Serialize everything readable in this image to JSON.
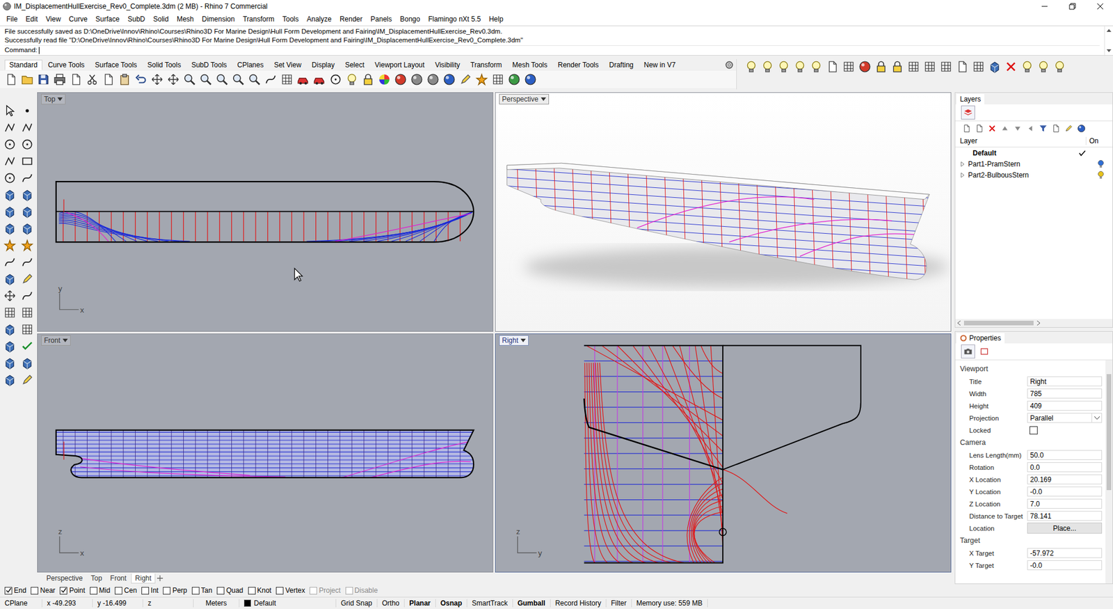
{
  "window": {
    "title": "IM_DisplacementHullExercise_Rev0_Complete.3dm (2 MB) - Rhino 7 Commercial"
  },
  "menu": [
    "File",
    "Edit",
    "View",
    "Curve",
    "Surface",
    "SubD",
    "Solid",
    "Mesh",
    "Dimension",
    "Transform",
    "Tools",
    "Analyze",
    "Render",
    "Panels",
    "Bongo",
    "Flamingo nXt 5.5",
    "Help"
  ],
  "command": {
    "history": [
      "File successfully saved as D:\\OneDrive\\Innov\\Rhino\\Courses\\Rhino3D For Marine Design\\Hull Form Development and Fairing\\IM_DisplacementHullExercise_Rev0.3dm.",
      "Successfully read file \"D:\\OneDrive\\Innov\\Rhino\\Courses\\Rhino3D For Marine Design\\Hull Form Development and Fairing\\IM_DisplacementHullExercise_Rev0_Complete.3dm\""
    ],
    "prompt": "Command:"
  },
  "toolbar_tabs": [
    {
      "label": "Standard",
      "selected": true
    },
    {
      "label": "Curve Tools",
      "selected": false
    },
    {
      "label": "Surface Tools",
      "selected": false
    },
    {
      "label": "Solid Tools",
      "selected": false
    },
    {
      "label": "SubD Tools",
      "selected": false
    },
    {
      "label": "CPlanes",
      "selected": false
    },
    {
      "label": "Set View",
      "selected": false
    },
    {
      "label": "Display",
      "selected": false
    },
    {
      "label": "Select",
      "selected": false
    },
    {
      "label": "Viewport Layout",
      "selected": false
    },
    {
      "label": "Visibility",
      "selected": false
    },
    {
      "label": "Transform",
      "selected": false
    },
    {
      "label": "Mesh Tools",
      "selected": false
    },
    {
      "label": "Render Tools",
      "selected": false
    },
    {
      "label": "Drafting",
      "selected": false
    },
    {
      "label": "New in V7",
      "selected": false
    }
  ],
  "viewports": [
    {
      "title": "Top",
      "kind": "plan",
      "active": false,
      "axis_labels": [
        "y",
        "x"
      ]
    },
    {
      "title": "Perspective",
      "kind": "perspective",
      "active": false,
      "axis_labels": []
    },
    {
      "title": "Front",
      "kind": "profile",
      "active": false,
      "axis_labels": [
        "z",
        "x"
      ]
    },
    {
      "title": "Right",
      "kind": "body",
      "active": true,
      "axis_labels": [
        "z",
        "y"
      ]
    }
  ],
  "viewport_tabs": [
    {
      "label": "Perspective",
      "selected": false
    },
    {
      "label": "Top",
      "selected": false
    },
    {
      "label": "Front",
      "selected": false
    },
    {
      "label": "Right",
      "selected": true
    }
  ],
  "osnaps": [
    {
      "label": "End",
      "checked": true,
      "disabled": false
    },
    {
      "label": "Near",
      "checked": false,
      "disabled": false
    },
    {
      "label": "Point",
      "checked": true,
      "disabled": false
    },
    {
      "label": "Mid",
      "checked": false,
      "disabled": false
    },
    {
      "label": "Cen",
      "checked": false,
      "disabled": false
    },
    {
      "label": "Int",
      "checked": false,
      "disabled": false
    },
    {
      "label": "Perp",
      "checked": false,
      "disabled": false
    },
    {
      "label": "Tan",
      "checked": false,
      "disabled": false
    },
    {
      "label": "Quad",
      "checked": false,
      "disabled": false
    },
    {
      "label": "Knot",
      "checked": false,
      "disabled": false
    },
    {
      "label": "Vertex",
      "checked": false,
      "disabled": false
    },
    {
      "label": "Project",
      "checked": false,
      "disabled": true
    },
    {
      "label": "Disable",
      "checked": false,
      "disabled": true
    }
  ],
  "status_bar": {
    "cplane": "CPlane",
    "coords": [
      "x -49.293",
      "y -16.499",
      "z"
    ],
    "units": "Meters",
    "layer": {
      "name": "Default",
      "color": "#000000"
    },
    "toggles": [
      {
        "label": "Grid Snap",
        "on": false
      },
      {
        "label": "Ortho",
        "on": false
      },
      {
        "label": "Planar",
        "on": true
      },
      {
        "label": "Osnap",
        "on": true
      },
      {
        "label": "SmartTrack",
        "on": false
      },
      {
        "label": "Gumball",
        "on": true
      },
      {
        "label": "Record History",
        "on": false
      },
      {
        "label": "Filter",
        "on": false
      }
    ],
    "memory": "Memory use: 559 MB"
  },
  "layers_panel": {
    "title": "Layers",
    "columns": [
      "Layer",
      "On"
    ],
    "layers": [
      {
        "name": "Default",
        "current": true,
        "expandable": false,
        "expanded": false,
        "bulb_color": ""
      },
      {
        "name": "Part1-PramStern",
        "current": false,
        "expandable": true,
        "expanded": false,
        "bulb_color": "#2f6fd6"
      },
      {
        "name": "Part2-BulbousStern",
        "current": false,
        "expandable": true,
        "expanded": false,
        "bulb_color": "#e8c31c"
      }
    ]
  },
  "properties_panel": {
    "title": "Properties",
    "sections": [
      {
        "heading": "Viewport",
        "rows": [
          {
            "label": "Title",
            "value": "Right",
            "kind": "text"
          },
          {
            "label": "Width",
            "value": "785",
            "kind": "text"
          },
          {
            "label": "Height",
            "value": "409",
            "kind": "text"
          },
          {
            "label": "Projection",
            "value": "Parallel",
            "kind": "select"
          },
          {
            "label": "Locked",
            "value": "",
            "kind": "checkbox",
            "checked": false
          }
        ]
      },
      {
        "heading": "Camera",
        "rows": [
          {
            "label": "Lens Length(mm)",
            "value": "50.0",
            "kind": "text"
          },
          {
            "label": "Rotation",
            "value": "0.0",
            "kind": "text"
          },
          {
            "label": "X Location",
            "value": "20.169",
            "kind": "text"
          },
          {
            "label": "Y Location",
            "value": "-0.0",
            "kind": "text"
          },
          {
            "label": "Z Location",
            "value": "7.0",
            "kind": "text"
          },
          {
            "label": "Distance to Target",
            "value": "78.141",
            "kind": "text"
          },
          {
            "label": "Location",
            "value": "Place...",
            "kind": "button"
          }
        ]
      },
      {
        "heading": "Target",
        "rows": [
          {
            "label": "X Target",
            "value": "-57.972",
            "kind": "text"
          },
          {
            "label": "Y Target",
            "value": "-0.0",
            "kind": "text"
          }
        ]
      }
    ]
  }
}
